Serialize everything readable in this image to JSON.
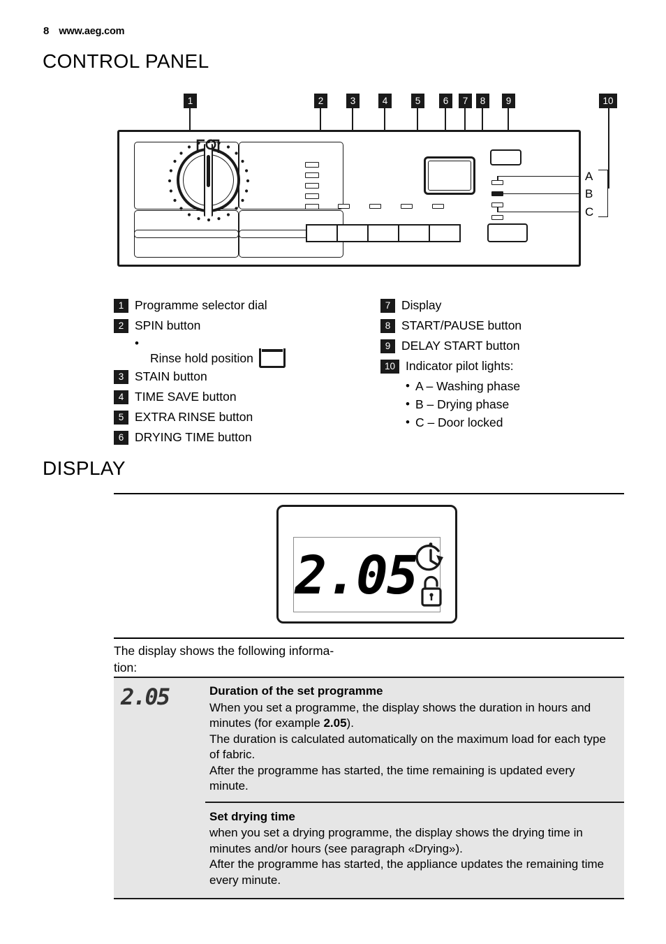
{
  "header": {
    "page_number": "8",
    "site": "www.aeg.com"
  },
  "sections": {
    "control_panel_title": "CONTROL PANEL",
    "display_title": "DISPLAY"
  },
  "diagram": {
    "callouts": [
      "1",
      "2",
      "3",
      "4",
      "5",
      "6",
      "7",
      "8",
      "9",
      "10"
    ],
    "pilot_labels": [
      "A",
      "B",
      "C"
    ]
  },
  "legend_left": [
    {
      "num": "1",
      "text": "Programme selector dial"
    },
    {
      "num": "2",
      "text": "SPIN button"
    },
    {
      "num": "3",
      "text": "STAIN button"
    },
    {
      "num": "4",
      "text": "TIME SAVE button"
    },
    {
      "num": "5",
      "text": "EXTRA RINSE button"
    },
    {
      "num": "6",
      "text": "DRYING TIME button"
    }
  ],
  "legend_left_sub": {
    "bullet": "•",
    "text": "Rinse hold position",
    "icon": "rinse-hold-icon"
  },
  "legend_right": [
    {
      "num": "7",
      "text": "Display"
    },
    {
      "num": "8",
      "text": "START/PAUSE button"
    },
    {
      "num": "9",
      "text": "DELAY START button"
    },
    {
      "num": "10",
      "text": "Indicator pilot lights:"
    }
  ],
  "legend_right_sub": [
    {
      "bullet": "•",
      "text": "A – Washing phase"
    },
    {
      "bullet": "•",
      "text": "B – Drying phase"
    },
    {
      "bullet": "•",
      "text": "C – Door locked"
    }
  ],
  "lcd": {
    "value": "2.05",
    "icons": [
      "delay-start-clock-icon",
      "door-lock-icon"
    ]
  },
  "info": {
    "intro": "The display shows the following informa-\ntion:",
    "rows": [
      {
        "icon_value": "2.05",
        "title": "Duration of the set programme",
        "body_pre": "When you set a programme, the display shows the duration in hours and minutes (for example ",
        "body_bold": "2.05",
        "body_post": ").\nThe duration is calculated automatically on the maximum load for each type of fabric.\nAfter the programme has started, the time remaining is updated every minute."
      },
      {
        "icon_value": "",
        "title": "Set drying time",
        "body_pre": "when you set a drying programme, the display shows the drying time in minutes and/or hours (see paragraph «Drying»).\nAfter the programme has started, the appliance updates the remaining time every minute.",
        "body_bold": "",
        "body_post": ""
      }
    ]
  },
  "colors": {
    "ink": "#1a1a1a",
    "table_bg": "#e6e6e6",
    "lcd_border": "#8c8c8c"
  }
}
